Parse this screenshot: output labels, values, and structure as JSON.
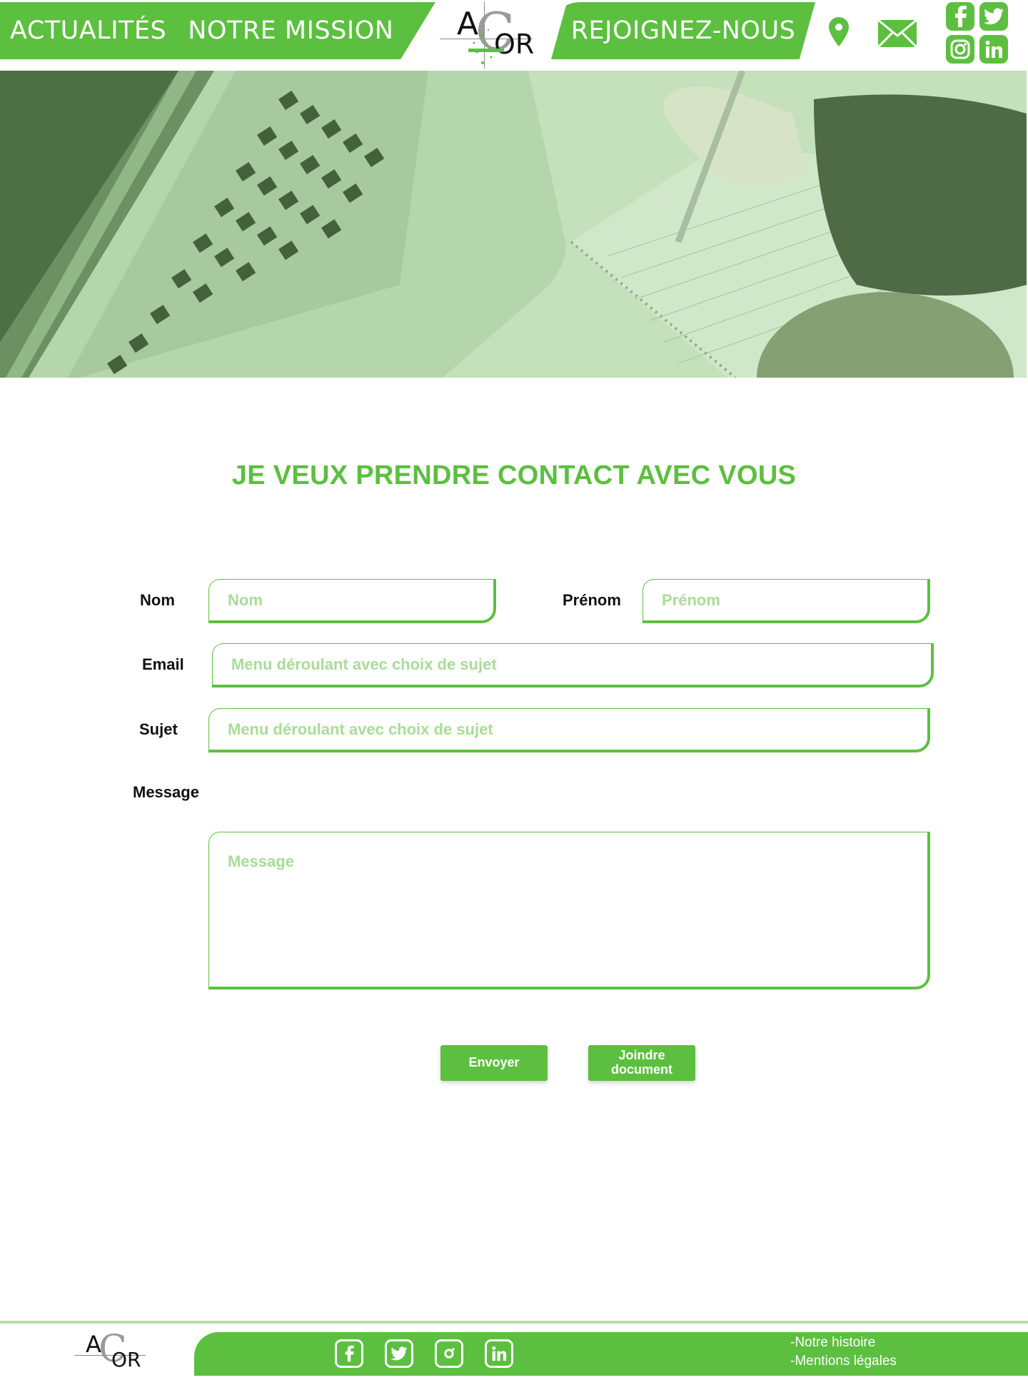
{
  "nav": {
    "left_links": [
      "ACTUALITÉS",
      "NOTRE MISSION"
    ],
    "join_link": "REJOIGNEZ-NOUS",
    "icons": [
      "map-pin-icon",
      "envelope-icon"
    ],
    "social": [
      "facebook-icon",
      "twitter-icon",
      "instagram-icon",
      "linkedin-icon"
    ]
  },
  "logo": {
    "letter_a": "A",
    "letter_c": "C",
    "letters_or": "OR"
  },
  "colors": {
    "brand_green": "#5cbf3f",
    "placeholder_green": "#a9dc98",
    "footer_line": "#b8dfad"
  },
  "page": {
    "title": "JE VEUX PRENDRE CONTACT AVEC VOUS"
  },
  "form": {
    "nom_label": "Nom",
    "nom_placeholder": "Nom",
    "prenom_label": "Prénom",
    "prenom_placeholder": "Prénom",
    "email_label": "Email",
    "email_placeholder": "Menu déroulant avec choix de sujet",
    "sujet_label": "Sujet",
    "sujet_placeholder": "Menu déroulant avec choix de sujet",
    "message_label": "Message",
    "message_placeholder": "Message"
  },
  "buttons": {
    "send": "Envoyer",
    "attach_line1": "Joindre",
    "attach_line2": "document"
  },
  "footer": {
    "links": [
      "-Notre histoire",
      "-Mentions légales"
    ],
    "social": [
      "facebook-icon",
      "twitter-icon",
      "instagram-icon",
      "linkedin-icon"
    ]
  }
}
